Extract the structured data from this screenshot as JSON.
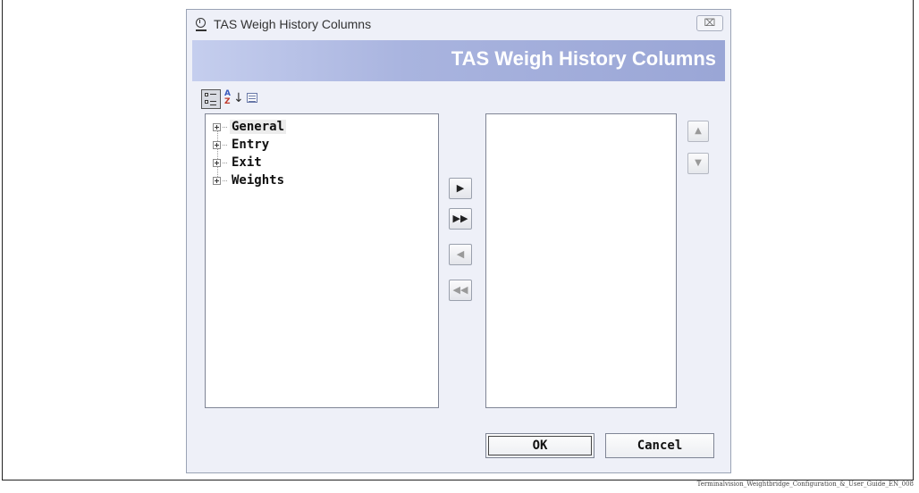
{
  "window": {
    "title": "TAS Weigh History Columns",
    "close_glyph": "⌧"
  },
  "banner": {
    "title": "TAS Weigh History Columns"
  },
  "toolbar": {
    "categorized_icon": "categorized-view-icon",
    "alphabetical_icon": "sort-alphabetical-icon",
    "alpha_a": "A",
    "alpha_z": "Z",
    "alpha_arrow": "↓",
    "list_icon": "list-view-icon"
  },
  "available_tree": {
    "items": [
      {
        "label": "General",
        "selected": true
      },
      {
        "label": "Entry",
        "selected": false
      },
      {
        "label": "Exit",
        "selected": false
      },
      {
        "label": "Weights",
        "selected": false
      }
    ]
  },
  "transfer_buttons": {
    "add": "▶",
    "add_all": "▶▶",
    "remove": "◀",
    "remove_all": "◀◀"
  },
  "order_buttons": {
    "up": "▲",
    "down": "▼"
  },
  "buttons": {
    "ok": "OK",
    "cancel": "Cancel"
  },
  "caption": "Terminalvision_Weightbridge_Configuration_&_User_Guide_EN_008"
}
